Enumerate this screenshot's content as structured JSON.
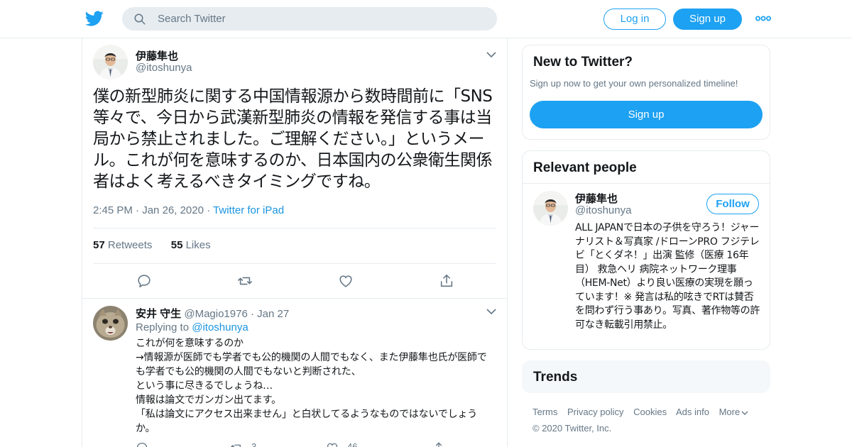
{
  "header": {
    "search_placeholder": "Search Twitter",
    "login_label": "Log in",
    "signup_label": "Sign up",
    "brand_color": "#1da1f2",
    "logo_icon": "twitter-bird-icon",
    "more_icon": "more-dots-icon"
  },
  "tweet": {
    "author_name": "伊藤隼也",
    "author_handle": "@itoshunya",
    "text": "僕の新型肺炎に関する中国情報源から数時間前に「SNS等々で、今日から武漢新型肺炎の情報を発信する事は当局から禁止されました。ご理解ください。」というメール。これが何を意味するのか、日本国内の公衆衛生関係者はよく考えるべきタイミングですね。",
    "time": "2:45 PM",
    "date": "Jan 26, 2020",
    "source": "Twitter for iPad",
    "retweets_count": "57",
    "retweets_label": "Retweets",
    "likes_count": "55",
    "likes_label": "Likes"
  },
  "reply": {
    "author_name": "安井 守生",
    "author_handle": "@Magio1976",
    "date": "Jan 27",
    "replying_to_label": "Replying to",
    "replying_to_handle": "@itoshunya",
    "text": "これが何を意味するのか\n→情報源が医師でも学者でも公的機関の人間でもなく、また伊藤隼也氏が医師でも学者でも公的機関の人間でもないと判断された、\nという事に尽きるでしょうね…\n情報は論文でガンガン出てます。\n「私は論文にアクセス出来ません」と白状してるようなものではないでしょうか。",
    "retweet_count": "3",
    "like_count": "46"
  },
  "sidebar": {
    "new_to_twitter": {
      "title": "New to Twitter?",
      "subtitle": "Sign up now to get your own personalized timeline!",
      "signup_label": "Sign up"
    },
    "relevant_people": {
      "title": "Relevant people",
      "name": "伊藤隼也",
      "handle": "@itoshunya",
      "follow_label": "Follow",
      "bio": "ALL JAPANで日本の子供を守ろう！ジャーナリスト＆写真家 /ドローンPRO フジテレビ「とくダネ！」出演 監修（医療 16年目） 救急ヘリ 病院ネットワーク理事（HEM-Net）より良い医療の実現を願っています！※ 発言は私的呟きでRTは賛否を問わず行う事あり。写真、著作物等の許可なき転載引用禁止。"
    },
    "trends": {
      "title": "Trends"
    },
    "footer": {
      "links": [
        "Terms",
        "Privacy policy",
        "Cookies",
        "Ads info",
        "More"
      ],
      "copyright": "© 2020 Twitter, Inc."
    }
  }
}
